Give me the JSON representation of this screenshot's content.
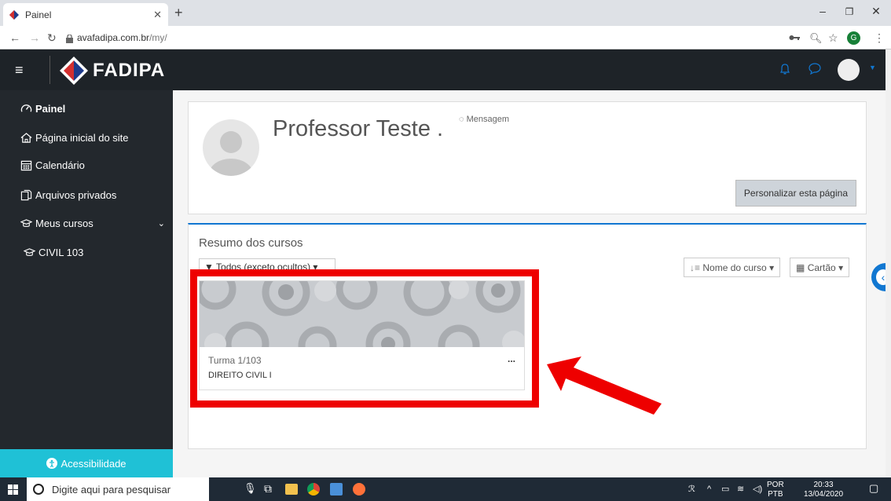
{
  "browser": {
    "tab_title": "Painel",
    "url_domain": "avafadipa.com.br",
    "url_path": "/my/",
    "profile_initial": "G"
  },
  "navbar": {
    "brand": "FADIPA"
  },
  "sidebar": {
    "items": [
      {
        "label": "Painel",
        "icon": "dashboard-icon"
      },
      {
        "label": "Página inicial do site",
        "icon": "home-icon"
      },
      {
        "label": "Calendário",
        "icon": "calendar-icon"
      },
      {
        "label": "Arquivos privados",
        "icon": "files-icon"
      },
      {
        "label": "Meus cursos",
        "icon": "graduation-cap-icon"
      },
      {
        "label": "CIVIL 103",
        "icon": "graduation-cap-icon"
      }
    ],
    "accessibility_label": "Acessibilidade"
  },
  "profile": {
    "name": "Professor Teste .",
    "message_label": "Mensagem",
    "customize_label": "Personalizar esta página"
  },
  "course_overview": {
    "title": "Resumo dos cursos",
    "filter_label": "Todos (exceto ocultos)",
    "sort_label": "Nome do curso",
    "view_label": "Cartão",
    "courses": [
      {
        "category": "Turma 1/103",
        "name": "DIREITO CIVIL I",
        "menu": "..."
      }
    ]
  },
  "taskbar": {
    "search_placeholder": "Digite aqui para pesquisar",
    "lang_top": "POR",
    "lang_bottom": "PTB",
    "time": "20:33",
    "date": "13/04/2020"
  },
  "colors": {
    "navbar": "#1e2328",
    "sidebar": "#23282d",
    "accent": "#1177d1",
    "accessibility": "#1fc1d6",
    "annotation_red": "#ee0000"
  }
}
